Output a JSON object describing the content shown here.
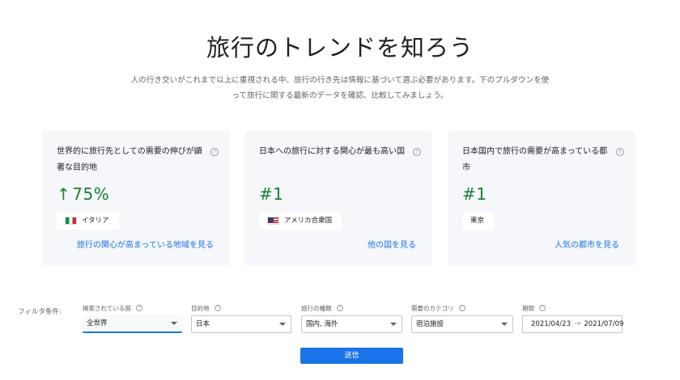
{
  "header": {
    "title": "旅行のトレンドを知ろう",
    "intro": "人の行き交いがこれまで以上に重視される中、旅行の行き先は情報に基づいて選ぶ必要があります。下のプルダウンを使って旅行に関する最新のデータを確認、比較してみましょう。"
  },
  "cards": [
    {
      "question": "世界的に旅行先としての需要の伸びが顕著な目的地",
      "value_arrow": "↑",
      "value": "75%",
      "chip_label": "イタリア",
      "chip_icon": "italy-flag-icon",
      "link": "旅行の関心が高まっている地域を見る"
    },
    {
      "question": "日本への旅行に対する関心が最も高い国",
      "value": "#1",
      "chip_label": "アメリカ合衆国",
      "chip_icon": "us-flag-icon",
      "link": "他の国を見る"
    },
    {
      "question": "日本国内で旅行の需要が高まっている都市",
      "value": "#1",
      "chip_label": "東京",
      "link": "人気の都市を見る"
    }
  ],
  "filters": {
    "title": "フィルタ条件:",
    "items": [
      {
        "label": "検索されている国",
        "value": "全世界"
      },
      {
        "label": "目的地",
        "value": "日本"
      },
      {
        "label": "旅行の種類",
        "value": "国内, 海外"
      },
      {
        "label": "需要のカテゴリ",
        "value": "宿泊施設"
      }
    ],
    "period": {
      "label": "期間",
      "start": "2021/04/23",
      "end": "2021/07/09"
    }
  },
  "submit_label": "送信",
  "colors": {
    "accent": "#1a73e8",
    "positive": "#188038",
    "card_bg": "#f5f7fa"
  }
}
